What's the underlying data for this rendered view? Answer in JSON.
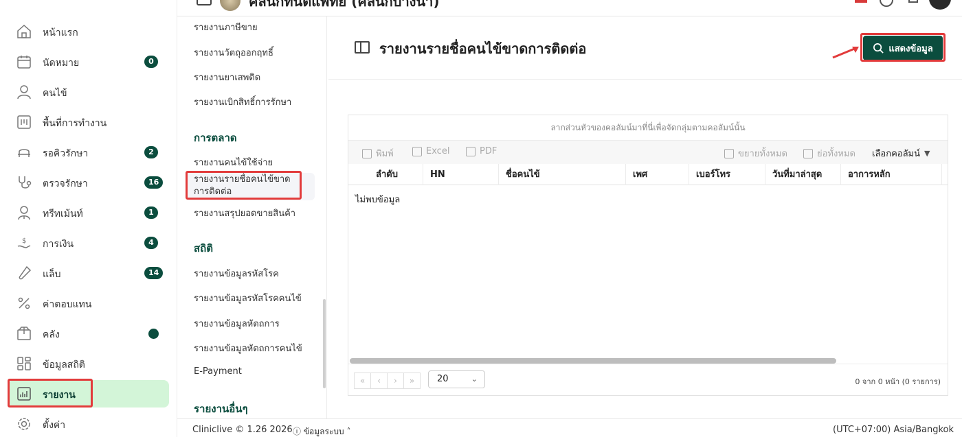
{
  "topbar": {
    "title": "คลินิกทันตแพทย์ (คลินิกบางนา)"
  },
  "sidebar": {
    "items": [
      {
        "label": "หน้าแรก",
        "badge": ""
      },
      {
        "label": "นัดหมาย",
        "badge": "0"
      },
      {
        "label": "คนไข้",
        "badge": ""
      },
      {
        "label": "พื้นที่การทำงาน",
        "badge": ""
      },
      {
        "label": "รอคิวรักษา",
        "badge": "2"
      },
      {
        "label": "ตรวจรักษา",
        "badge": "16"
      },
      {
        "label": "ทรีทเม้นท์",
        "badge": "1"
      },
      {
        "label": "การเงิน",
        "badge": "4"
      },
      {
        "label": "แล็บ",
        "badge": "14"
      },
      {
        "label": "ค่าตอบแทน",
        "badge": ""
      },
      {
        "label": "คลัง",
        "badge": ""
      },
      {
        "label": "ข้อมูลสถิติ",
        "badge": ""
      },
      {
        "label": "รายงาน",
        "badge": ""
      },
      {
        "label": "ตั้งค่า",
        "badge": ""
      }
    ]
  },
  "submenu": {
    "links_top": [
      "รายงานภาษีขาย",
      "รายงานวัตถุออกฤทธิ์",
      "รายงานยาเสพติด",
      "รายงานเบิกสิทธิ์การรักษา"
    ],
    "section_marketing": "การตลาด",
    "marketing_links": [
      "รายงานคนไข้ใช้จ่าย",
      "รายงานรายชื่อคนไข้ขาดการติดต่อ",
      "รายงานสรุปยอดขายสินค้า"
    ],
    "section_stats": "สถิติ",
    "stats_links": [
      "รายงานข้อมูลรหัสโรค",
      "รายงานข้อมูลรหัสโรคคนไข้",
      "รายงานข้อมูลหัตถการ",
      "รายงานข้อมูลหัตถการคนไข้",
      "E-Payment"
    ],
    "section_other": "รายงานอื่นๆ"
  },
  "main": {
    "title": "รายงานรายชื่อคนไข้ขาดการติดต่อ",
    "show_button": "แสดงข้อมูล"
  },
  "grid": {
    "group_hint": "ลากส่วนหัวของคอลัมน์มาที่นี่เพื่อจัดกลุ่มตามคอลัมน์นั้น",
    "toolbar": {
      "print": "พิมพ์",
      "excel": "Excel",
      "pdf": "PDF",
      "expand_all": "ขยายทั้งหมด",
      "collapse_all": "ย่อทั้งหมด",
      "choose_columns": "เลือกคอลัมน์"
    },
    "columns": [
      "ลำดับ",
      "HN",
      "ชื่อคนไข้",
      "เพศ",
      "เบอร์โทร",
      "วันที่มาล่าสุด",
      "อาการหลัก"
    ],
    "no_data": "ไม่พบข้อมูล",
    "pager": {
      "first": "«",
      "prev": "‹",
      "next": "›",
      "last": "»",
      "page_size": "20",
      "info": "0 จาก 0 หน้า (0 รายการ)"
    }
  },
  "footer": {
    "brand": "Cliniclive © 1.26 2026",
    "system_info": "ข้อมูลระบบ",
    "timezone": "(UTC+07:00) Asia/Bangkok"
  },
  "colors": {
    "primary": "#0b4d3e",
    "active_bg": "#d3f5d8",
    "highlight": "#e23b3b"
  }
}
